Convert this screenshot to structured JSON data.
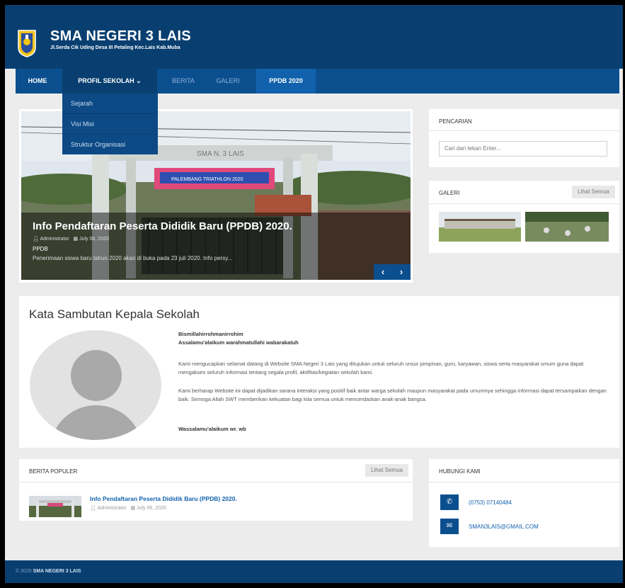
{
  "header": {
    "title": "SMA NEGERI 3 LAIS",
    "subtitle": "Jl.Serda Cik Uding Desa III Petaling Kec.Lais Kab.Muba"
  },
  "nav": {
    "items": [
      {
        "label": "HOME"
      },
      {
        "label": "PROFIL SEKOLAH ⌄"
      },
      {
        "label": "BERITA"
      },
      {
        "label": "GALERI"
      },
      {
        "label": "PPDB 2020"
      }
    ],
    "dropdown": [
      "Sejarah",
      "Visi Misi",
      "Struktur Organisasi"
    ]
  },
  "slider": {
    "sign_text": "SMA N. 3 LAIS",
    "banner_text": "PALEMBANG TRIATHLON 2020",
    "title": "Info Pendaftaran Peserta Dididik Baru (PPDB) 2020.",
    "author": "Administrator",
    "date": "July 06, 2020",
    "category": "PPDB",
    "excerpt": "Penerimaan siswa baru tahun 2020 akan di buka pada 23 juli 2020. Info persy..."
  },
  "pencarian": {
    "title": "PENCARIAN",
    "placeholder": "Cari dan tekan Enter..."
  },
  "galeri": {
    "title": "GALERI",
    "see_all": "Lihat Semua"
  },
  "sambutan": {
    "title": "Kata Sambutan Kepala Sekolah",
    "greeting1": "Bismillahirrohmanirrohim",
    "greeting2": "Assalamu'alaikum warahmatullahi wabarakatuh",
    "para1": "Kami mengucapkan selamat datang di Website SMA Negeri 3 Lais yang ditujukan untuk seluruh unsur pimpinan, guru, karyawan, siswa serta masyarakat umum guna dapat mengakses seluruh informasi tentang segala profil, aktifitas/kegiatan sekolah kami.",
    "para2": "Kami berharap Website ini dapat dijadikan sarana interaksi yang positif baik antar warga sekolah maupun masyarakat pada umumnya sehingga informasi dapat tersampaikan dengan baik. Semoga Allah SWT memberikan kekuatan bagi kita semua untuk mencerdaskan anak-anak bangsa.",
    "closing": "Wassalamu'alaikum wr. wb"
  },
  "berita_populer": {
    "title": "BERITA POPULER",
    "see_all": "Lihat Semua",
    "items": [
      {
        "title": "Info Pendaftaran Peserta Dididik Baru (PPDB) 2020.",
        "author": "Administrator",
        "date": "July 06, 2020"
      }
    ]
  },
  "hubungi": {
    "title": "HUBUNGI KAMI",
    "phone": "(0753) 07140484",
    "email": "SMAN3LAIS@GMAIL.COM"
  },
  "footer": {
    "year": "© 2020",
    "name": "SMA NEGERI 3 LAIS"
  },
  "icons": [
    "school-logo-icon",
    "user-icon",
    "calendar-icon",
    "chevron-left-icon",
    "chevron-right-icon",
    "phone-icon",
    "mail-icon"
  ],
  "colors": {
    "header": "#093f70",
    "nav": "#0c4f8f",
    "accent": "#1261ad"
  }
}
